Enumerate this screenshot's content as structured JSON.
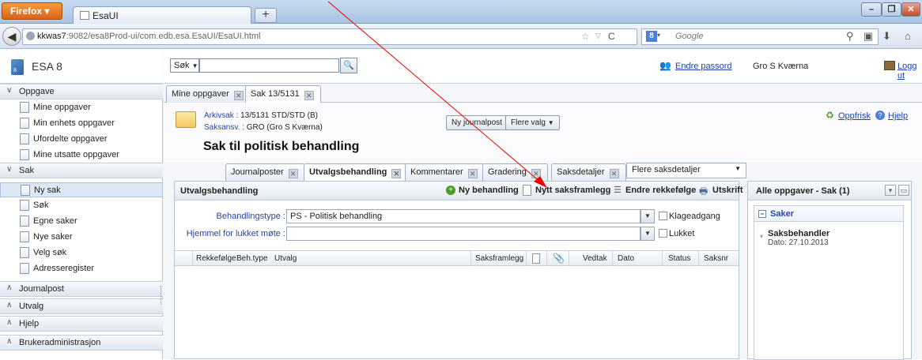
{
  "browser": {
    "menu_label": "Firefox",
    "tab_title": "EsaUI",
    "new_tab": "+",
    "url_host": "kkwas7",
    "url_rest": ":9082/esa8Prod-ui/com.edb.esa.EsaUI/EsaUI.html",
    "search_placeholder": "Google",
    "search_engine_badge": "8",
    "window_buttons": [
      "–",
      "❐",
      "✕"
    ]
  },
  "sidebar": {
    "app_title": "ESA 8",
    "logo_badge": "8",
    "sections": [
      {
        "label": "Oppgave",
        "expanded": true,
        "items": [
          "Mine oppgaver",
          "Min enhets oppgaver",
          "Ufordelte oppgaver",
          "Mine utsatte oppgaver"
        ]
      },
      {
        "label": "Sak",
        "expanded": true,
        "items": [
          "Ny sak",
          "Søk",
          "Egne saker",
          "Nye saker",
          "Velg søk",
          "Adresseregister"
        ]
      },
      {
        "label": "Journalpost",
        "expanded": false,
        "items": []
      },
      {
        "label": "Utvalg",
        "expanded": false,
        "items": []
      },
      {
        "label": "Hjelp",
        "expanded": false,
        "items": []
      },
      {
        "label": "Brukeradministrasjon",
        "expanded": false,
        "items": []
      }
    ],
    "selected_item": "Ny sak"
  },
  "topbar": {
    "search_type": "Søk",
    "change_password": "Endre passord",
    "user_name": "Gro S Kværna",
    "logout": "Logg ut"
  },
  "main_tabs": [
    "Mine oppgaver",
    "Sak 13/5131"
  ],
  "case": {
    "arkivsak_label": "Arkivsak :",
    "arkivsak_value": "13/5131 STD/STD (B)",
    "saksansv_label": "Saksansv. :",
    "saksansv_value": "GRO (Gro S Kværna)",
    "new_journalpost": "Ny journalpost",
    "more_choices": "Flere valg",
    "title": "Sak til politisk behandling",
    "refresh": "Oppfrisk",
    "help": "Hjelp"
  },
  "sub_tabs": [
    "Journalposter",
    "Utvalgsbehandling",
    "Kommentarer",
    "Gradering",
    "Saksdetaljer"
  ],
  "more_details": "Flere saksdetaljer",
  "panel": {
    "title": "Utvalgsbehandling",
    "toolbar": [
      "Ny behandling",
      "Nytt saksframlegg",
      "Endre rekkefølge",
      "Utskrift"
    ],
    "behandlingstype_label": "Behandlingstype :",
    "behandlingstype_value": "PS - Politisk behandling",
    "klageadgang": "Klageadgang",
    "hjemmel_label": "Hjemmel for lukket møte :",
    "hjemmel_value": "",
    "lukket": "Lukket",
    "columns": [
      "Rekkefølge",
      "Beh.type",
      "Utvalg",
      "Saksframlegg",
      "Vedtak",
      "Dato",
      "Status",
      "Saksnr"
    ]
  },
  "right_panel": {
    "title": "Alle oppgaver - Sak (1)",
    "group": "Saker",
    "task_title": "Saksbehandler",
    "task_date": "Dato: 27.10.2013"
  }
}
